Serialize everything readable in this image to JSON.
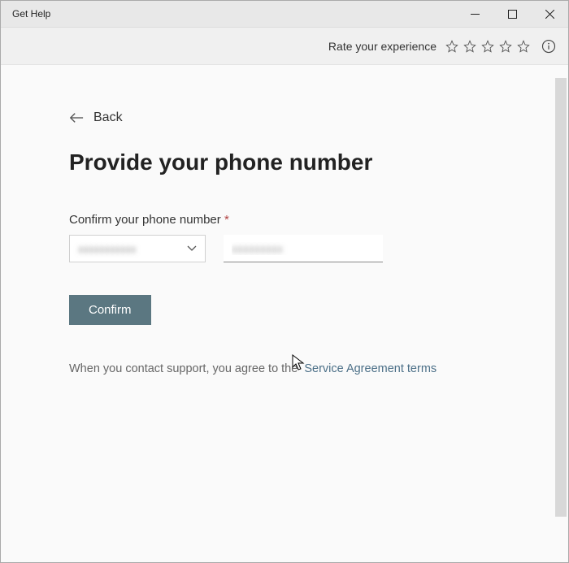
{
  "window": {
    "title": "Get Help"
  },
  "rating": {
    "label": "Rate your experience"
  },
  "back": {
    "label": "Back"
  },
  "heading": "Provide your phone number",
  "form": {
    "field_label": "Confirm your phone number",
    "required_marker": "*",
    "country_value": "xxxxxxxxxxx",
    "phone_value": "xxxxxxxxx",
    "confirm_label": "Confirm"
  },
  "legal": {
    "text": "When you contact support, you agree to the",
    "link": "Service Agreement terms"
  }
}
